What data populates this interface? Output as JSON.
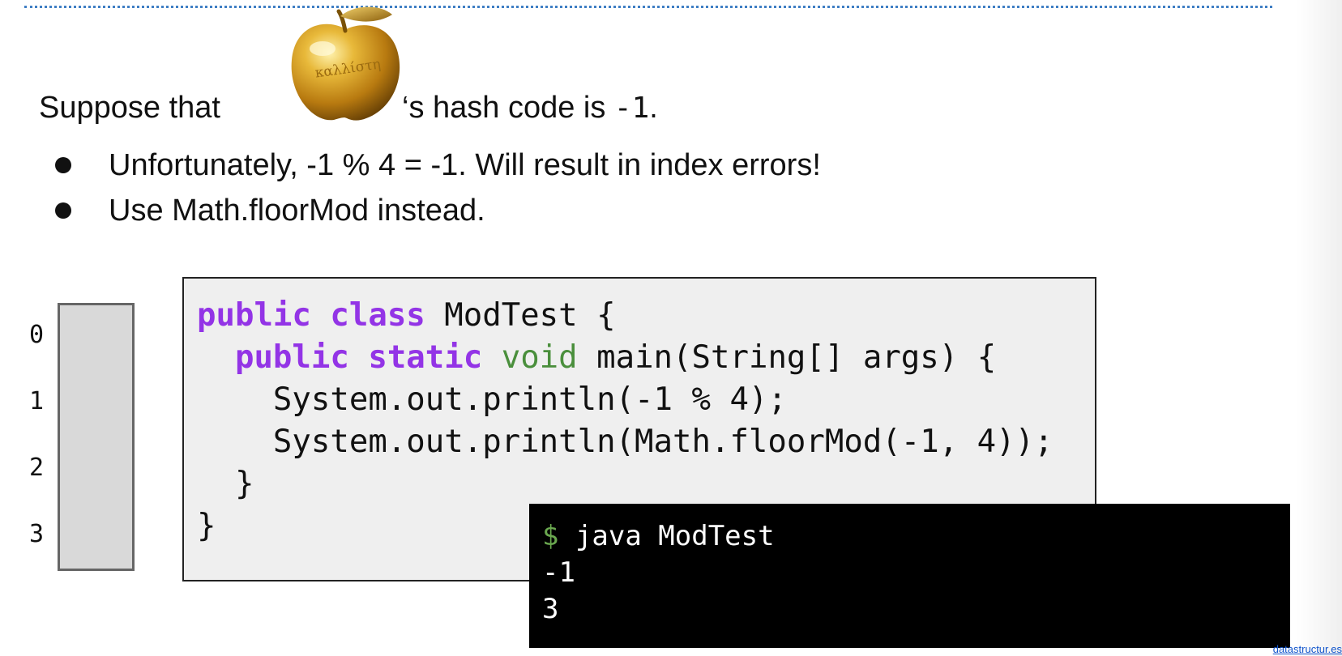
{
  "intro": {
    "before_image": "Suppose that",
    "after_image_text": "‘s hash code is ",
    "hash_code": "-1",
    "period": "."
  },
  "apple_image": {
    "icon": "golden-apple-icon",
    "engraving": "καλλίστη"
  },
  "bullets": [
    "Unfortunately, -1 % 4 = -1. Will result in index errors!",
    "Use Math.floorMod instead."
  ],
  "array": {
    "indices": [
      "0",
      "1",
      "2",
      "3"
    ]
  },
  "code": {
    "line1": {
      "kw1": "public",
      "kw2": "class",
      "rest": " ModTest {"
    },
    "line2": {
      "indent": "  ",
      "kw1": "public",
      "kw2": "static",
      "type": "void",
      "rest": " main(String[] args) {"
    },
    "line3": "    System.out.println(-1 % 4);",
    "line4": "    System.out.println(Math.floorMod(-1, 4));",
    "line5": "  }",
    "line6": "}"
  },
  "terminal": {
    "prompt": "$",
    "command": " java ModTest",
    "outputs": [
      "-1",
      "3"
    ]
  },
  "footer": {
    "link_text": "datastructur.es"
  },
  "colors": {
    "keyword": "#9334e6",
    "type": "#4a8f3c",
    "prompt": "#6aa84f",
    "code_bg": "#efefef",
    "terminal_bg": "#000000",
    "array_cell": "#d9d9d9"
  }
}
